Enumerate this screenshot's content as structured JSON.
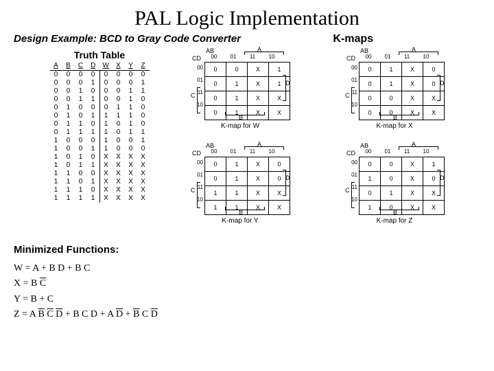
{
  "title": "PAL Logic Implementation",
  "subtitle": "Design Example: BCD to Gray Code Converter",
  "kmaps_label": "K-maps",
  "truth_table": {
    "title": "Truth Table",
    "headers": [
      "A",
      "B",
      "C",
      "D",
      "W",
      "X",
      "Y",
      "Z"
    ],
    "rows": [
      [
        "0",
        "0",
        "0",
        "0",
        "0",
        "0",
        "0",
        "0"
      ],
      [
        "0",
        "0",
        "0",
        "1",
        "0",
        "0",
        "0",
        "1"
      ],
      [
        "0",
        "0",
        "1",
        "0",
        "0",
        "0",
        "1",
        "1"
      ],
      [
        "0",
        "0",
        "1",
        "1",
        "0",
        "0",
        "1",
        "0"
      ],
      [
        "0",
        "1",
        "0",
        "0",
        "0",
        "1",
        "1",
        "0"
      ],
      [
        "0",
        "1",
        "0",
        "1",
        "1",
        "1",
        "1",
        "0"
      ],
      [
        "0",
        "1",
        "1",
        "0",
        "1",
        "0",
        "1",
        "0"
      ],
      [
        "0",
        "1",
        "1",
        "1",
        "1",
        "0",
        "1",
        "1"
      ],
      [
        "1",
        "0",
        "0",
        "0",
        "1",
        "0",
        "0",
        "1"
      ],
      [
        "1",
        "0",
        "0",
        "1",
        "1",
        "0",
        "0",
        "0"
      ],
      [
        "1",
        "0",
        "1",
        "0",
        "X",
        "X",
        "X",
        "X"
      ],
      [
        "1",
        "0",
        "1",
        "1",
        "X",
        "X",
        "X",
        "X"
      ],
      [
        "1",
        "1",
        "0",
        "0",
        "X",
        "X",
        "X",
        "X"
      ],
      [
        "1",
        "1",
        "0",
        "1",
        "X",
        "X",
        "X",
        "X"
      ],
      [
        "1",
        "1",
        "1",
        "0",
        "X",
        "X",
        "X",
        "X"
      ],
      [
        "1",
        "1",
        "1",
        "1",
        "X",
        "X",
        "X",
        "X"
      ]
    ]
  },
  "minimized_title": "Minimized Functions:",
  "equations": {
    "W": "W = A + B D + B C",
    "X": "X = B C̄",
    "Y": "Y = B + C",
    "Z": "Z = A B̄ C̄ D̄ + B C D + A D̄ + B̄ C D̄"
  },
  "kmap_labels": {
    "AB": "AB",
    "CD": "CD",
    "A": "A",
    "B": "B",
    "C": "C",
    "D": "D"
  },
  "kmap_col_headers": [
    "00",
    "01",
    "11",
    "10"
  ],
  "kmap_row_headers": [
    "00",
    "01",
    "11",
    "10"
  ],
  "kmaps": [
    {
      "caption": "K-map for W",
      "cells": [
        [
          "0",
          "0",
          "X",
          "1"
        ],
        [
          "0",
          "1",
          "X",
          "1"
        ],
        [
          "0",
          "1",
          "X",
          "X"
        ],
        [
          "0",
          "1",
          "X",
          "X"
        ]
      ]
    },
    {
      "caption": "K-map for X",
      "cells": [
        [
          "0",
          "1",
          "X",
          "0"
        ],
        [
          "0",
          "1",
          "X",
          "0"
        ],
        [
          "0",
          "0",
          "X",
          "X"
        ],
        [
          "0",
          "0",
          "X",
          "X"
        ]
      ]
    },
    {
      "caption": "K-map for Y",
      "cells": [
        [
          "0",
          "1",
          "X",
          "0"
        ],
        [
          "0",
          "1",
          "X",
          "0"
        ],
        [
          "1",
          "1",
          "X",
          "X"
        ],
        [
          "1",
          "1",
          "X",
          "X"
        ]
      ]
    },
    {
      "caption": "K-map for Z",
      "cells": [
        [
          "0",
          "0",
          "X",
          "1"
        ],
        [
          "1",
          "0",
          "X",
          "0"
        ],
        [
          "0",
          "1",
          "X",
          "X"
        ],
        [
          "1",
          "0",
          "X",
          "X"
        ]
      ]
    }
  ]
}
